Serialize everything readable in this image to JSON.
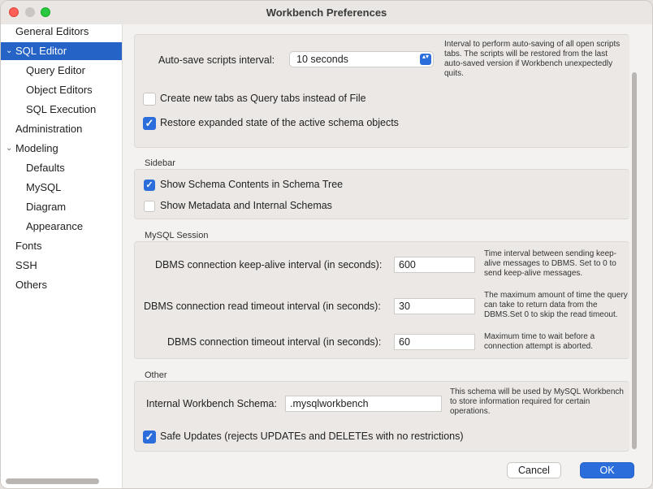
{
  "window": {
    "title": "Workbench Preferences"
  },
  "sidebar": {
    "items": [
      {
        "label": "General Editors"
      },
      {
        "label": "SQL Editor",
        "chevron": "⌄"
      },
      {
        "label": "Query Editor"
      },
      {
        "label": "Object Editors"
      },
      {
        "label": "SQL Execution"
      },
      {
        "label": "Administration"
      },
      {
        "label": "Modeling",
        "chevron": "⌄"
      },
      {
        "label": "Defaults"
      },
      {
        "label": "MySQL"
      },
      {
        "label": "Diagram"
      },
      {
        "label": "Appearance"
      },
      {
        "label": "Fonts"
      },
      {
        "label": "SSH"
      },
      {
        "label": "Others"
      }
    ]
  },
  "general": {
    "autosave_label": "Auto-save scripts interval:",
    "autosave_value": "10 seconds",
    "autosave_help": "Interval to perform auto-saving of all open scripts\ntabs. The scripts will be restored from the last\nauto-saved version if Workbench unexpectedly\nquits.",
    "query_tabs_label": "Create new tabs as Query tabs instead of File",
    "query_tabs_checked": false,
    "restore_label": "Restore expanded state of the active schema objects",
    "restore_checked": true
  },
  "sidebar_section": {
    "title": "Sidebar",
    "schema_contents_label": "Show Schema Contents in Schema Tree",
    "schema_contents_checked": true,
    "metadata_label": "Show Metadata and Internal Schemas",
    "metadata_checked": false
  },
  "session": {
    "title": "MySQL Session",
    "keepalive_label": "DBMS connection keep-alive interval (in seconds):",
    "keepalive_value": "600",
    "keepalive_help": "Time interval between sending keep-\nalive messages to DBMS. Set to 0 to\nsend keep-alive messages.",
    "read_timeout_label": "DBMS connection read timeout interval (in seconds):",
    "read_timeout_value": "30",
    "read_timeout_help": "The maximum amount of time the query\ncan take to return data from the\nDBMS.Set 0 to skip the read timeout.",
    "conn_timeout_label": "DBMS connection timeout interval (in seconds):",
    "conn_timeout_value": "60",
    "conn_timeout_help": "Maximum time to wait before a\nconnection attempt is aborted."
  },
  "other": {
    "title": "Other",
    "schema_label": "Internal Workbench Schema:",
    "schema_value": ".mysqlworkbench",
    "schema_help": "This schema will be used by MySQL Workbench\nto store information required for certain\noperations.",
    "safe_updates_label": "Safe Updates (rejects UPDATEs and DELETEs with no restrictions)",
    "safe_updates_checked": true
  },
  "buttons": {
    "cancel": "Cancel",
    "ok": "OK"
  },
  "icons": {
    "check": "✓",
    "select_arrows": "▴▾"
  },
  "colors": {
    "accent": "#2a6ddb",
    "selection": "#2563c7"
  }
}
